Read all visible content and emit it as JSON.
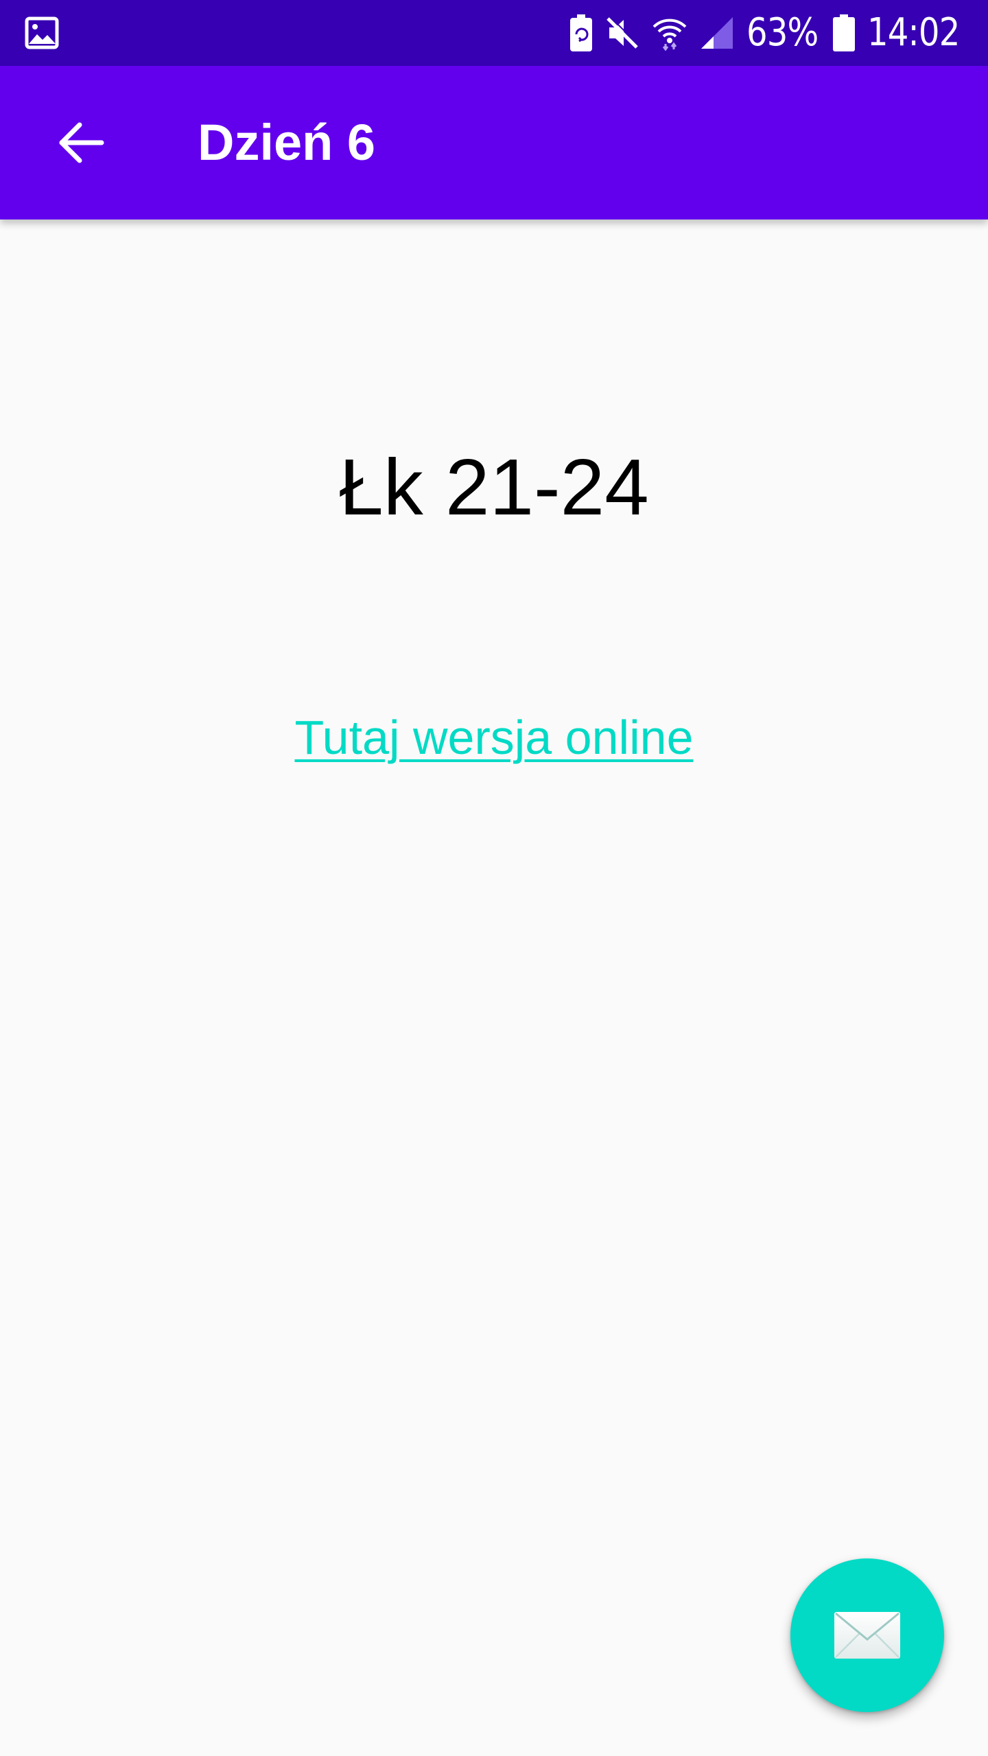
{
  "status_bar": {
    "battery_percent": "63%",
    "time": "14:02",
    "icons": [
      "gallery-notification-icon",
      "battery-saver-icon",
      "mute-icon",
      "wifi-icon",
      "signal-icon",
      "battery-icon"
    ]
  },
  "app_bar": {
    "title": "Dzień 6",
    "back_icon": "arrow-back-icon",
    "background": "#6200ee"
  },
  "content": {
    "reading_reference": "Łk 21-24",
    "online_link_label": "Tutaj wersja online"
  },
  "fab": {
    "icon": "envelope-icon",
    "color": "#03dac5"
  },
  "colors": {
    "status_bar": "#3700b3",
    "primary": "#6200ee",
    "accent": "#03dac5",
    "background": "#fafafa"
  }
}
